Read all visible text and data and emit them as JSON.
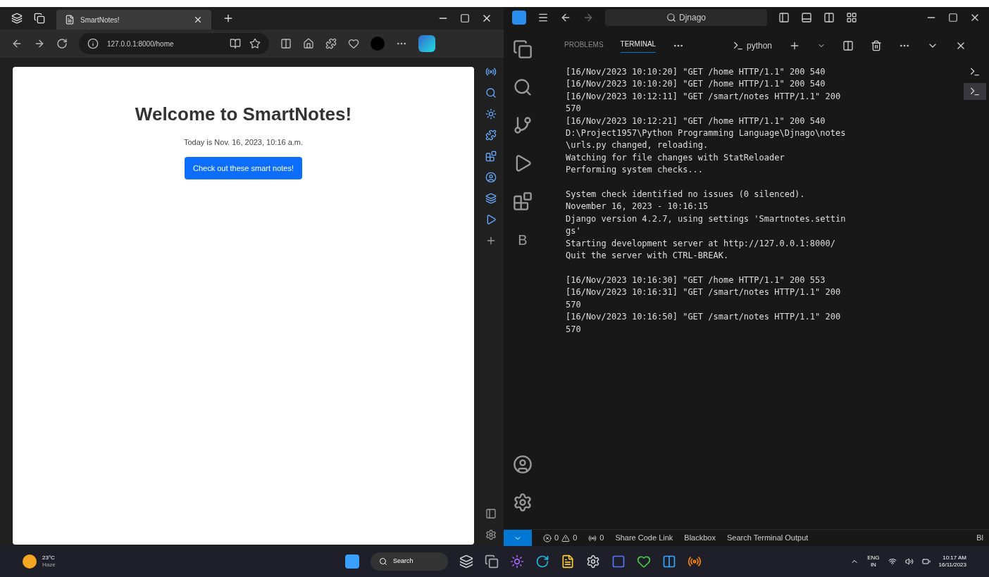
{
  "browser": {
    "tab_title": "SmartNotes!",
    "address": "127.0.0.1:8000/home",
    "page": {
      "heading": "Welcome to SmartNotes!",
      "date_line": "Today is Nov. 16, 2023, 10:16 a.m.",
      "button": "Check out these smart notes!"
    }
  },
  "vscode": {
    "search": "Djnago",
    "activity_letter": "B",
    "panel_tabs": [
      {
        "label": "PROBLEMS",
        "selected": false
      },
      {
        "label": "TERMINAL",
        "selected": true
      }
    ],
    "terminal_name": "python",
    "terminal_blocks": [
      [
        "[16/Nov/2023 10:10:20] \"GET /home HTTP/1.1\" 200 540",
        "[16/Nov/2023 10:10:20] \"GET /home HTTP/1.1\" 200 540",
        "[16/Nov/2023 10:12:11] \"GET /smart/notes HTTP/1.1\" 200",
        "570",
        "[16/Nov/2023 10:12:21] \"GET /home HTTP/1.1\" 200 540",
        "D:\\Project1957\\Python Programming Language\\Djnago\\notes",
        "\\urls.py changed, reloading.",
        "Watching for file changes with StatReloader",
        "Performing system checks..."
      ],
      [
        "System check identified no issues (0 silenced).",
        "November 16, 2023 - 10:16:15",
        "Django version 4.2.7, using settings 'Smartnotes.settin",
        "gs'",
        "Starting development server at http://127.0.0.1:8000/",
        "Quit the server with CTRL-BREAK."
      ],
      [
        "[16/Nov/2023 10:16:30] \"GET /home HTTP/1.1\" 200 553",
        "[16/Nov/2023 10:16:31] \"GET /smart/notes HTTP/1.1\" 200",
        "570",
        "[16/Nov/2023 10:16:50] \"GET /smart/notes HTTP/1.1\" 200",
        "570"
      ]
    ],
    "status": {
      "errors": "0",
      "warnings": "0",
      "ports": "0",
      "items": [
        "Share Code Link",
        "Blackbox",
        "Search Terminal Output",
        "Bl"
      ]
    }
  },
  "taskbar": {
    "temperature": "23°C",
    "weather": "Haze",
    "search": "Search",
    "language": "ENG",
    "region": "IN",
    "time": "10:17 AM",
    "date": "16/11/2023"
  }
}
